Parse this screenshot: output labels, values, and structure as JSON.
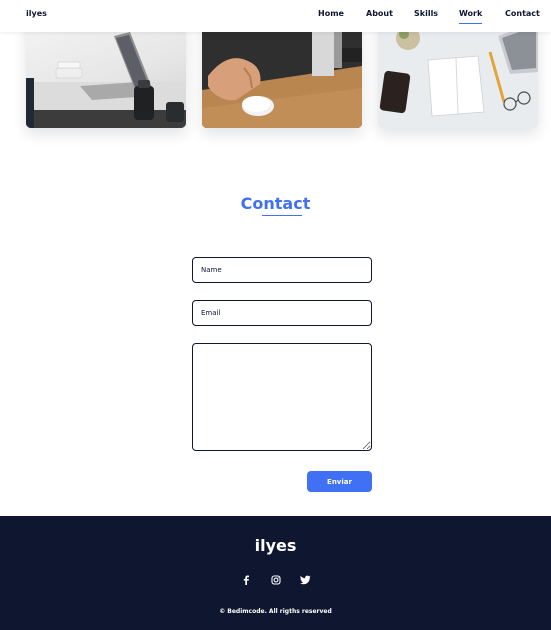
{
  "header": {
    "logo": "ilyes",
    "nav": [
      "Home",
      "About",
      "Skills",
      "Work",
      "Contact"
    ],
    "active_nav": "Work"
  },
  "work": {
    "images": [
      "laptop-desk-photo",
      "mouse-hand-photo",
      "desk-flatlay-photo"
    ]
  },
  "contact": {
    "title": "Contact",
    "name_placeholder": "Name",
    "email_placeholder": "Email",
    "message_placeholder": "",
    "submit_label": "Enviar"
  },
  "footer": {
    "title": "ilyes",
    "social_icons": [
      "facebook-icon",
      "instagram-icon",
      "twitter-icon"
    ],
    "copyright": "© Bedimcode. All rigths reserved"
  },
  "colors": {
    "accent": "#4070f4",
    "dark": "#0e1630",
    "white": "#ffffff"
  }
}
